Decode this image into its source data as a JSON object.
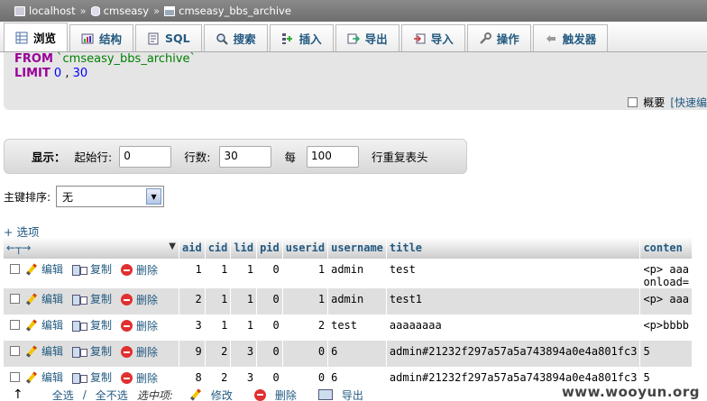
{
  "breadcrumb": {
    "server": "localhost",
    "database": "cmseasy",
    "table": "cmseasy_bbs_archive",
    "separator": "»"
  },
  "tabs": [
    {
      "label": "浏览",
      "icon": "browse-icon",
      "active": true
    },
    {
      "label": "结构",
      "icon": "structure-icon"
    },
    {
      "label": "SQL",
      "icon": "sql-icon"
    },
    {
      "label": "搜索",
      "icon": "search-icon"
    },
    {
      "label": "插入",
      "icon": "insert-icon"
    },
    {
      "label": "导出",
      "icon": "export-icon"
    },
    {
      "label": "导入",
      "icon": "import-icon"
    },
    {
      "label": "操作",
      "icon": "wrench-icon"
    },
    {
      "label": "触发器",
      "icon": "trigger-icon"
    }
  ],
  "sql": {
    "from_kw": "FROM",
    "table": "`cmseasy_bbs_archive`",
    "limit_kw": "LIMIT",
    "offset": "0",
    "comma": ",",
    "count": "30"
  },
  "sql_options": {
    "profiling_label": "概要",
    "quick_edit_label": "[快速编"
  },
  "display": {
    "label": "显示：",
    "start_label": "起始行:",
    "start_value": "0",
    "rows_label": "行数:",
    "rows_value": "30",
    "every_label": "每",
    "every_value": "100",
    "repeat_label": "行重复表头"
  },
  "sort": {
    "label": "主键排序:",
    "value": "无"
  },
  "options_link": "+ 选项",
  "table": {
    "columns": [
      "aid",
      "cid",
      "lid",
      "pid",
      "userid",
      "username",
      "title",
      "conten"
    ],
    "actions": {
      "edit": "编辑",
      "copy": "复制",
      "delete": "删除"
    },
    "rows": [
      {
        "aid": "1",
        "cid": "1",
        "lid": "1",
        "pid": "0",
        "userid": "1",
        "username": "admin",
        "title": "test",
        "content": "<p> aaa",
        "content2": "onload="
      },
      {
        "aid": "2",
        "cid": "1",
        "lid": "1",
        "pid": "0",
        "userid": "1",
        "username": "admin",
        "title": "test1",
        "content": "<p> aaa",
        "content2": ""
      },
      {
        "aid": "3",
        "cid": "1",
        "lid": "1",
        "pid": "0",
        "userid": "2",
        "username": "test",
        "title": "aaaaaaaa",
        "content": "<p>bbbb",
        "content2": ""
      },
      {
        "aid": "9",
        "cid": "2",
        "lid": "3",
        "pid": "0",
        "userid": "0",
        "username": "6",
        "title": "admin#21232f297a57a5a743894a0e4a801fc3",
        "content": "5",
        "content2": ""
      },
      {
        "aid": "8",
        "cid": "2",
        "lid": "3",
        "pid": "0",
        "userid": "0",
        "username": "6",
        "title": "admin#21232f297a57a5a743894a0e4a801fc3",
        "content": "5",
        "content2": ""
      }
    ]
  },
  "footer": {
    "check_all": "全选",
    "slash": "/",
    "uncheck_all": "全不选",
    "with_selected": "选中项:",
    "edit": "修改",
    "delete": "删除",
    "export": "导出"
  },
  "watermark": "www.wooyun.org",
  "colors": {
    "link": "#235a81",
    "keyword": "#990099",
    "string": "#008000",
    "number": "#0000ff",
    "row_alt": "#dfdfdf"
  }
}
